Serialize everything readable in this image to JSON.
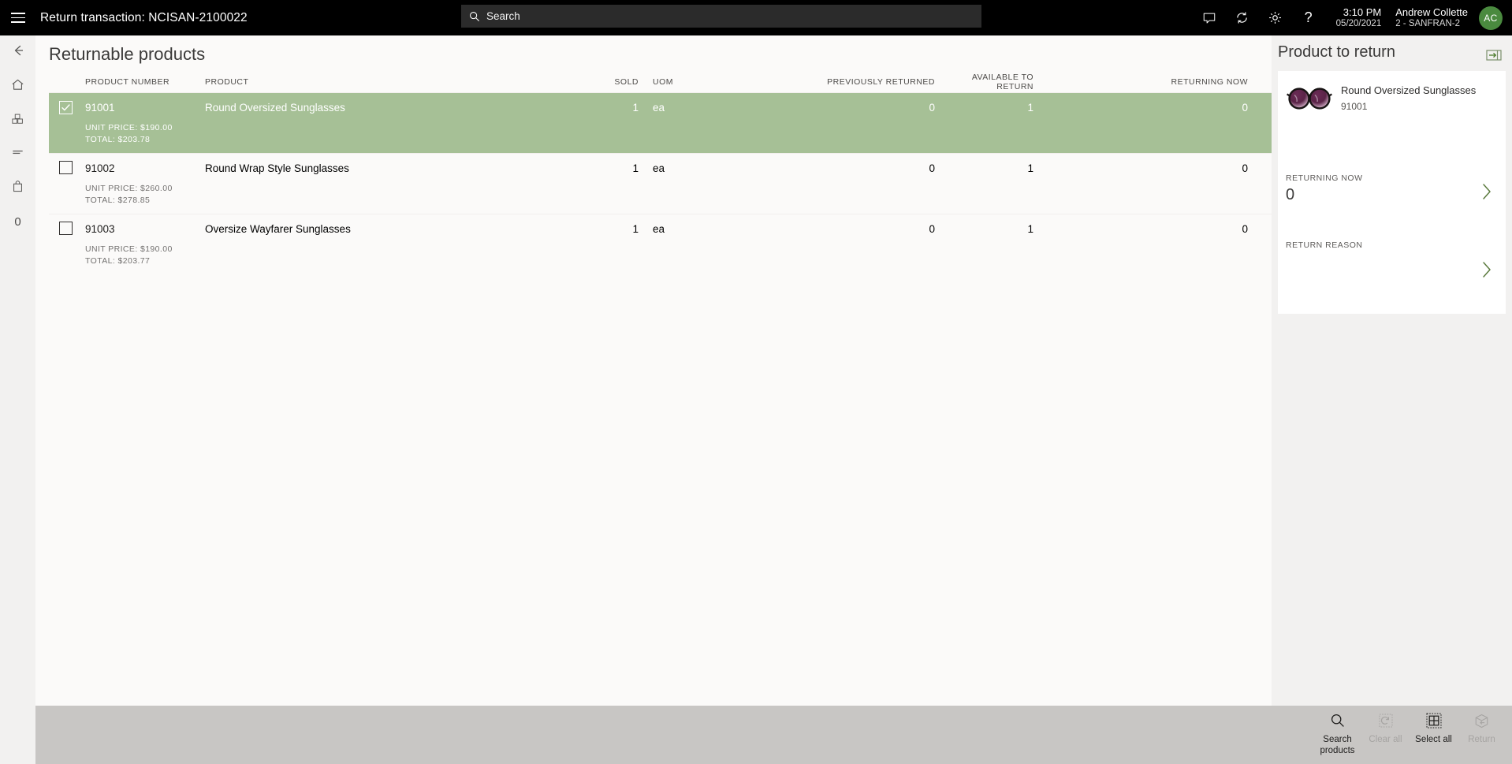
{
  "topbar": {
    "menu_icon": "hamburger-icon",
    "title": "Return transaction: NCISAN-2100022",
    "search_placeholder": "Search",
    "search_value": "",
    "icons": [
      "chat-icon",
      "sync-icon",
      "gear-icon",
      "help-icon"
    ],
    "time": "3:10 PM",
    "date": "05/20/2021",
    "user_name": "Andrew Collette",
    "user_store": "2 - SANFRAN-2",
    "avatar_initials": "AC",
    "avatar_color": "#4a8a3f"
  },
  "sidebar": {
    "items": [
      {
        "name": "back-icon"
      },
      {
        "name": "home-icon"
      },
      {
        "name": "products-icon"
      },
      {
        "name": "list-icon"
      },
      {
        "name": "bag-icon"
      },
      {
        "name": "zero-icon",
        "label": "0"
      }
    ]
  },
  "main": {
    "page_title": "Returnable products",
    "columns": [
      "PRODUCT NUMBER",
      "PRODUCT",
      "SOLD",
      "UOM",
      "PREVIOUSLY RETURNED",
      "AVAILABLE TO RETURN",
      "RETURNING NOW"
    ],
    "rows": [
      {
        "selected": true,
        "checked": true,
        "product_number": "91001",
        "product": "Round Oversized Sunglasses",
        "unit_price": "UNIT PRICE: $190.00",
        "total": "TOTAL: $203.78",
        "sold": "1",
        "uom": "ea",
        "previously_returned": "0",
        "available_to_return": "1",
        "returning_now": "0"
      },
      {
        "selected": false,
        "checked": false,
        "product_number": "91002",
        "product": "Round Wrap Style Sunglasses",
        "unit_price": "UNIT PRICE: $260.00",
        "total": "TOTAL: $278.85",
        "sold": "1",
        "uom": "ea",
        "previously_returned": "0",
        "available_to_return": "1",
        "returning_now": "0"
      },
      {
        "selected": false,
        "checked": false,
        "product_number": "91003",
        "product": "Oversize Wayfarer Sunglasses",
        "unit_price": "UNIT PRICE: $190.00",
        "total": "TOTAL: $203.77",
        "sold": "1",
        "uom": "ea",
        "previously_returned": "0",
        "available_to_return": "1",
        "returning_now": "0"
      }
    ]
  },
  "right_panel": {
    "title": "Product to return",
    "expand_icon": "expand-panel-icon",
    "product_name": "Round Oversized Sunglasses",
    "product_id": "91001",
    "product_image": "sunglasses-thumbnail",
    "returning_now_label": "RETURNING NOW",
    "returning_now_value": "0",
    "return_reason_label": "RETURN REASON",
    "return_reason_value": ""
  },
  "bottombar": {
    "buttons": [
      {
        "label": "Search products",
        "icon": "search-icon",
        "disabled": false
      },
      {
        "label": "Clear all",
        "icon": "clear-icon",
        "disabled": true
      },
      {
        "label": "Select all",
        "icon": "select-all-icon",
        "disabled": false
      },
      {
        "label": "Return",
        "icon": "return-box-icon",
        "disabled": true
      }
    ]
  },
  "colors": {
    "selected_row": "#a6c096",
    "topbar_bg": "#000000",
    "content_bg": "#fbfaf9",
    "panel_bg": "#f2f1f0",
    "bottombar_bg": "#c8c6c4",
    "accent_chevron": "#5b7a3e"
  }
}
